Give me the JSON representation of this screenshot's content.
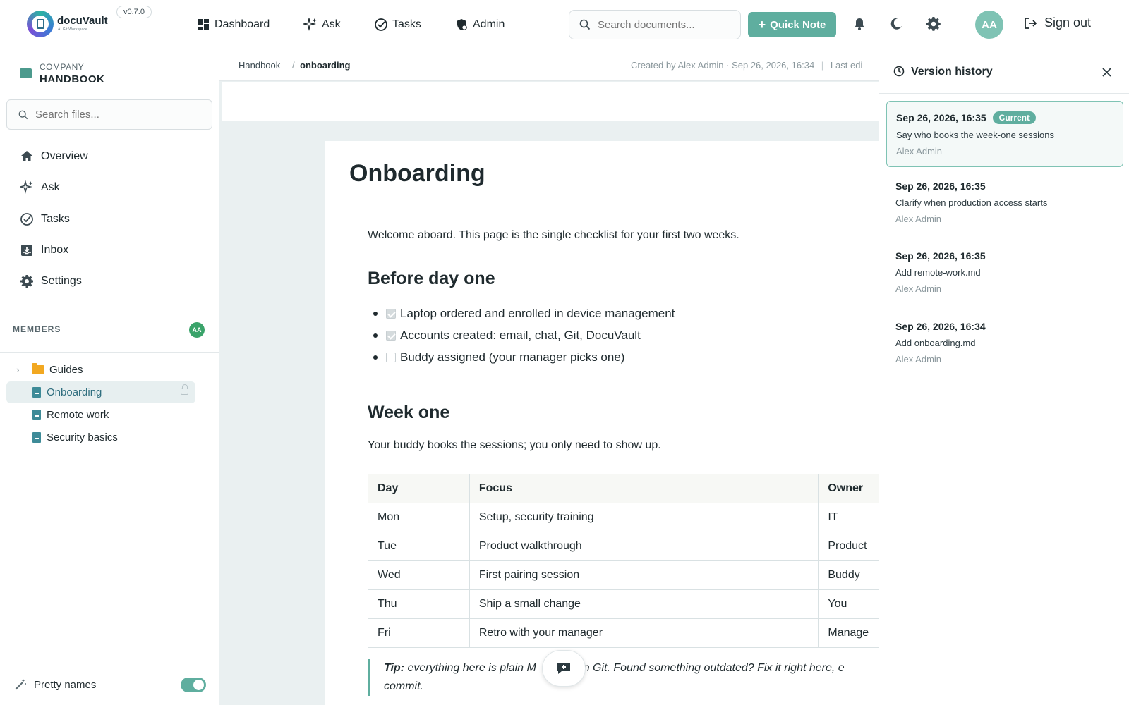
{
  "app": {
    "brand": "docuVault",
    "brand_sub": "AI Git Workspace",
    "version": "v0.7.0"
  },
  "topnav": {
    "items": [
      {
        "label": "Dashboard",
        "icon": "dashboard-icon"
      },
      {
        "label": "Ask",
        "icon": "sparkle-icon"
      },
      {
        "label": "Tasks",
        "icon": "check-circle-icon"
      },
      {
        "label": "Admin",
        "icon": "shield-icon"
      }
    ],
    "search_placeholder": "Search documents...",
    "quick_note_label": "Quick Note",
    "avatar_initials": "AA",
    "signout_label": "Sign out"
  },
  "sidebar": {
    "space_kicker": "COMPANY",
    "space_name": "HANDBOOK",
    "search_placeholder": "Search files...",
    "nav": [
      {
        "label": "Overview",
        "icon": "home-icon"
      },
      {
        "label": "Ask",
        "icon": "sparkle-icon"
      },
      {
        "label": "Tasks",
        "icon": "check-circle-icon"
      },
      {
        "label": "Inbox",
        "icon": "inbox-icon"
      },
      {
        "label": "Settings",
        "icon": "gear-icon"
      }
    ],
    "members_label": "MEMBERS",
    "members_avatar": "AA",
    "tree": {
      "folder": "Guides",
      "files": [
        "Onboarding",
        "Remote work",
        "Security basics"
      ],
      "active": "Onboarding"
    },
    "pretty_names_label": "Pretty names",
    "pretty_names_on": true
  },
  "breadcrumb": {
    "root": "Handbook",
    "separator": "/",
    "current": "onboarding",
    "meta": "Created by Alex Admin · Sep 26, 2026, 16:34",
    "meta_divider": "|",
    "meta_edit": "Last edi"
  },
  "doc": {
    "title": "Onboarding",
    "intro": "Welcome aboard. This page is the single checklist for your first two weeks.",
    "section1_title": "Before day one",
    "checklist": [
      {
        "text": "Laptop ordered and enrolled in device management",
        "checked": true
      },
      {
        "text": "Accounts created: email, chat, Git, DocuVault",
        "checked": true
      },
      {
        "text": "Buddy assigned (your manager picks one)",
        "checked": false
      }
    ],
    "section2_title": "Week one",
    "week_text": "Your buddy books the sessions; you only need to show up.",
    "table": {
      "headers": [
        "Day",
        "Focus",
        "Owner"
      ],
      "rows": [
        [
          "Mon",
          "Setup, security training",
          "IT"
        ],
        [
          "Tue",
          "Product walkthrough",
          "Product"
        ],
        [
          "Wed",
          "First pairing session",
          "Buddy"
        ],
        [
          "Thu",
          "Ship a small change",
          "You"
        ],
        [
          "Fri",
          "Retro with your manager",
          "Manage"
        ]
      ]
    },
    "tip_label": "Tip:",
    "tip_text_a": " everything here is plain M",
    "tip_text_b": "n in Git. Found something outdated? Fix it right here, e",
    "tip_text_c": "commit."
  },
  "version_panel": {
    "title": "Version history",
    "current_badge": "Current",
    "versions": [
      {
        "date": "Sep 26, 2026, 16:35",
        "message": "Say who books the week-one sessions",
        "author": "Alex Admin",
        "current": true
      },
      {
        "date": "Sep 26, 2026, 16:35",
        "message": "Clarify when production access starts",
        "author": "Alex Admin",
        "current": false
      },
      {
        "date": "Sep 26, 2026, 16:35",
        "message": "Add remote-work.md",
        "author": "Alex Admin",
        "current": false
      },
      {
        "date": "Sep 26, 2026, 16:34",
        "message": "Add onboarding.md",
        "author": "Alex Admin",
        "current": false
      }
    ]
  },
  "colors": {
    "accent": "#5fae9f",
    "active_item_bg": "#e7eff0",
    "folder": "#f2a821",
    "file": "#3e8b98"
  }
}
